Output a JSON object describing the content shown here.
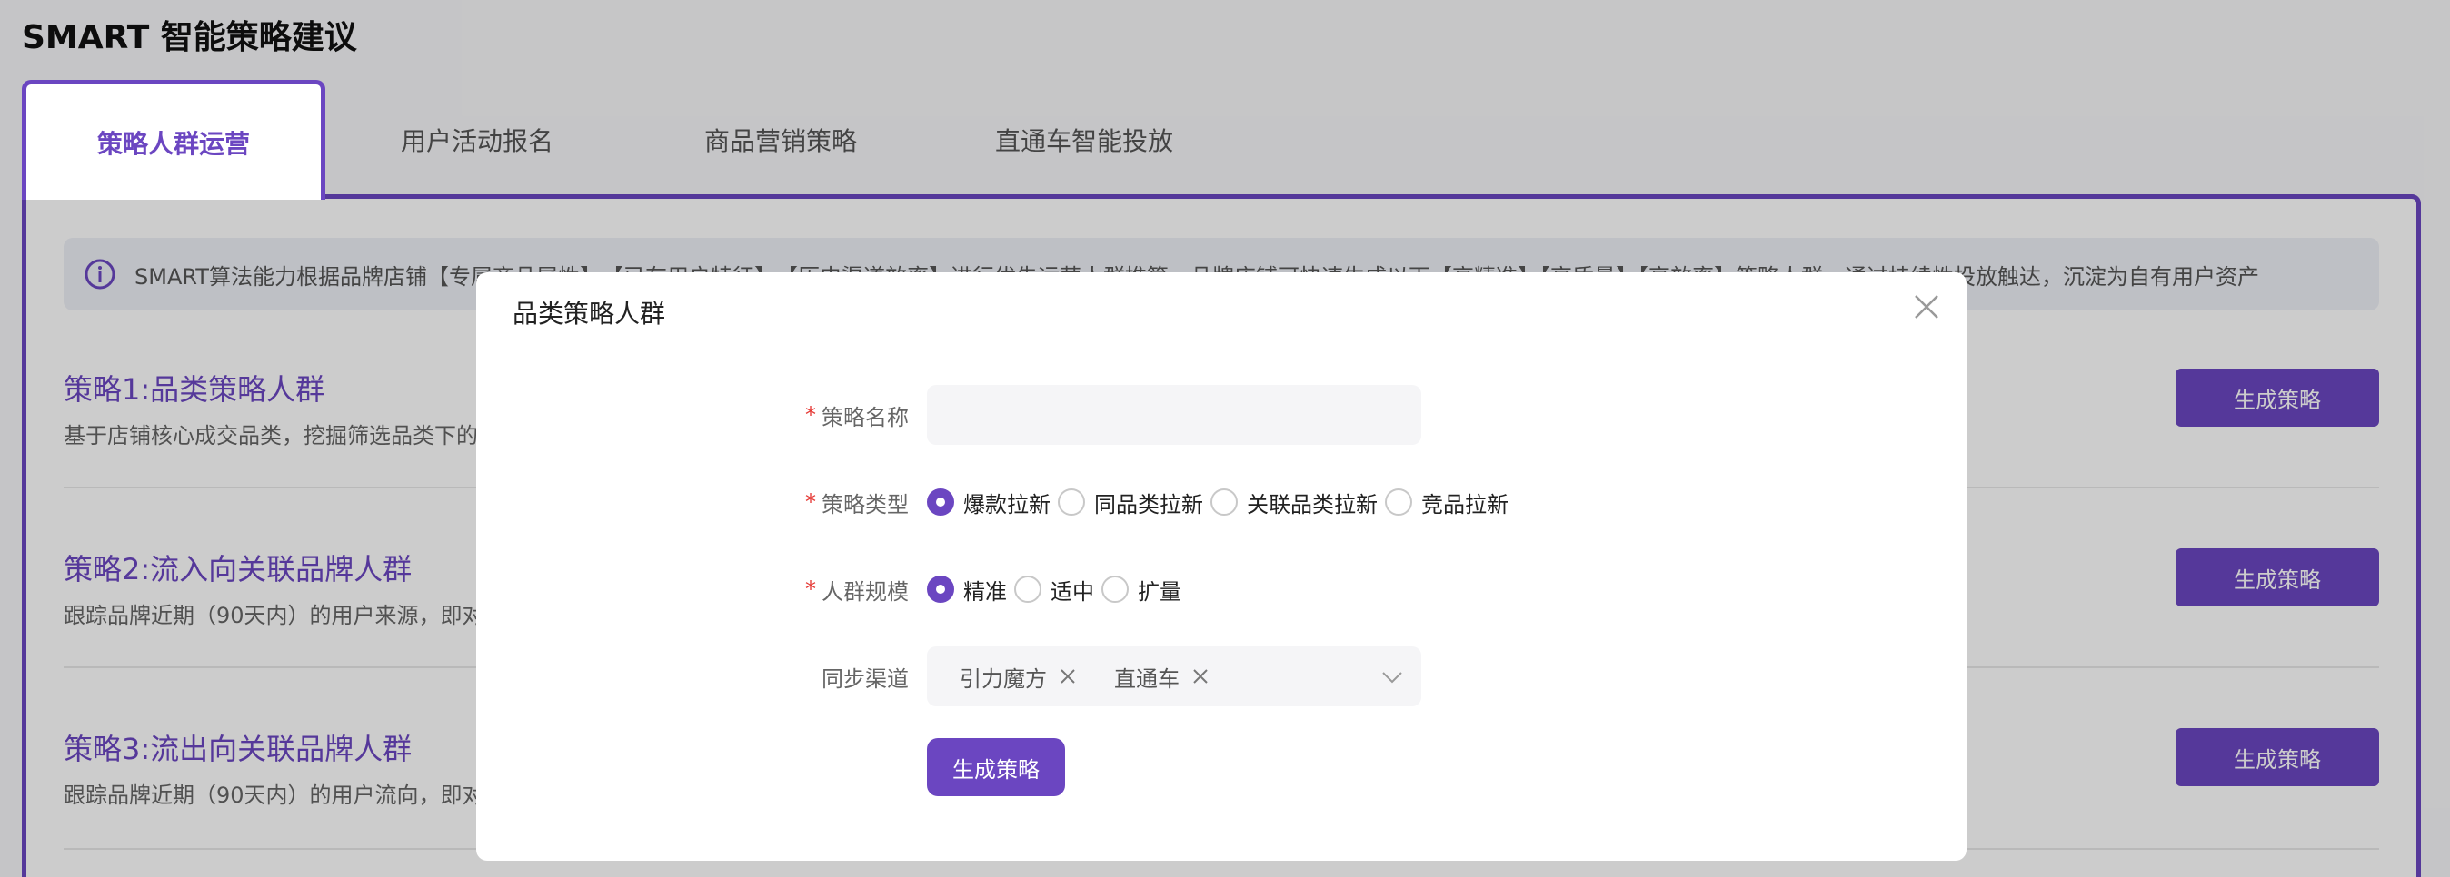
{
  "page": {
    "title": "SMART 智能策略建议"
  },
  "tabs": [
    {
      "label": "策略人群运营"
    },
    {
      "label": "用户活动报名"
    },
    {
      "label": "商品营销策略"
    },
    {
      "label": "直通车智能投放"
    }
  ],
  "tip": {
    "text": "SMART算法能力根据品牌店铺【专属商品属性】、【已有用户特征】、【历史渠道效率】进行优先运营人群推算，品牌店铺可快速生成以下【高精准】【高质量】【高效率】策略人群，通过持续性投放触达，沉淀为自有用户资产"
  },
  "strategies": [
    {
      "title": "策略1:品类策略人群",
      "desc": "基于店铺核心成交品类，挖掘筛选品类下的",
      "button": "生成策略"
    },
    {
      "title": "策略2:流入向关联品牌人群",
      "desc": "跟踪品牌近期（90天内）的用户来源，即对",
      "button": "生成策略"
    },
    {
      "title": "策略3:流出向关联品牌人群",
      "desc": "跟踪品牌近期（90天内）的用户流向，即对",
      "button": "生成策略"
    }
  ],
  "modal": {
    "title": "品类策略人群",
    "name_label": "策略名称",
    "name_value": "",
    "type_label": "策略类型",
    "type_options": [
      "爆款拉新",
      "同品类拉新",
      "关联品类拉新",
      "竞品拉新"
    ],
    "type_selected": "爆款拉新",
    "scale_label": "人群规模",
    "scale_options": [
      "精准",
      "适中",
      "扩量"
    ],
    "scale_selected": "精准",
    "channel_label": "同步渠道",
    "channel_tags": [
      "引力魔方",
      "直通车"
    ],
    "submit_label": "生成策略"
  },
  "colors": {
    "accent": "#6b46c1",
    "required": "#e53935"
  }
}
